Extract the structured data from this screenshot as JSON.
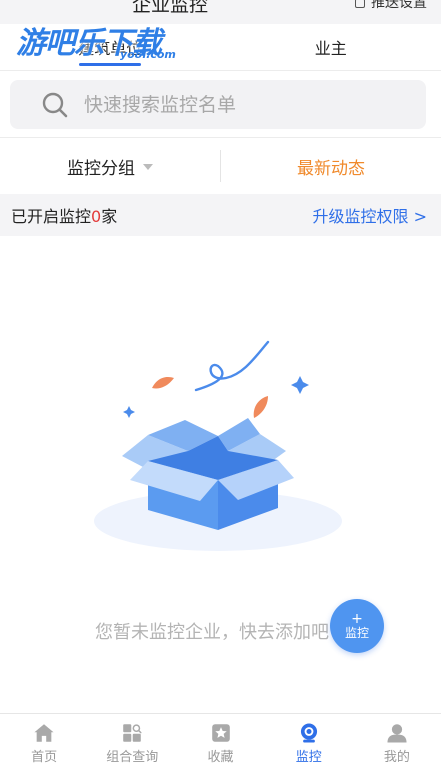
{
  "header": {
    "title": "企业监控",
    "push_setting": "推送设置"
  },
  "watermark": {
    "main": "游吧乐下载",
    "sub": "yo8l.com"
  },
  "tabs": [
    {
      "label": "建筑单位",
      "active": true
    },
    {
      "label": "业主",
      "active": false
    }
  ],
  "search": {
    "placeholder": "快速搜索监控名单"
  },
  "filters": {
    "group_label": "监控分组",
    "latest_label": "最新动态"
  },
  "info": {
    "prefix": "已开启监控",
    "count": "0",
    "suffix": "家",
    "upgrade_link": "升级监控权限 >"
  },
  "empty_state": {
    "message": "您暂未监控企业，快去添加吧"
  },
  "fab": {
    "plus": "+",
    "label": "监控"
  },
  "bottom_nav": [
    {
      "label": "首页",
      "icon": "home-icon",
      "active": false
    },
    {
      "label": "组合查询",
      "icon": "grid-search-icon",
      "active": false
    },
    {
      "label": "收藏",
      "icon": "star-icon",
      "active": false
    },
    {
      "label": "监控",
      "icon": "camera-icon",
      "active": true
    },
    {
      "label": "我的",
      "icon": "user-icon",
      "active": false
    }
  ],
  "colors": {
    "accent": "#2f6fe8",
    "orange": "#f08a2c",
    "count_red": "#e33b3b"
  }
}
